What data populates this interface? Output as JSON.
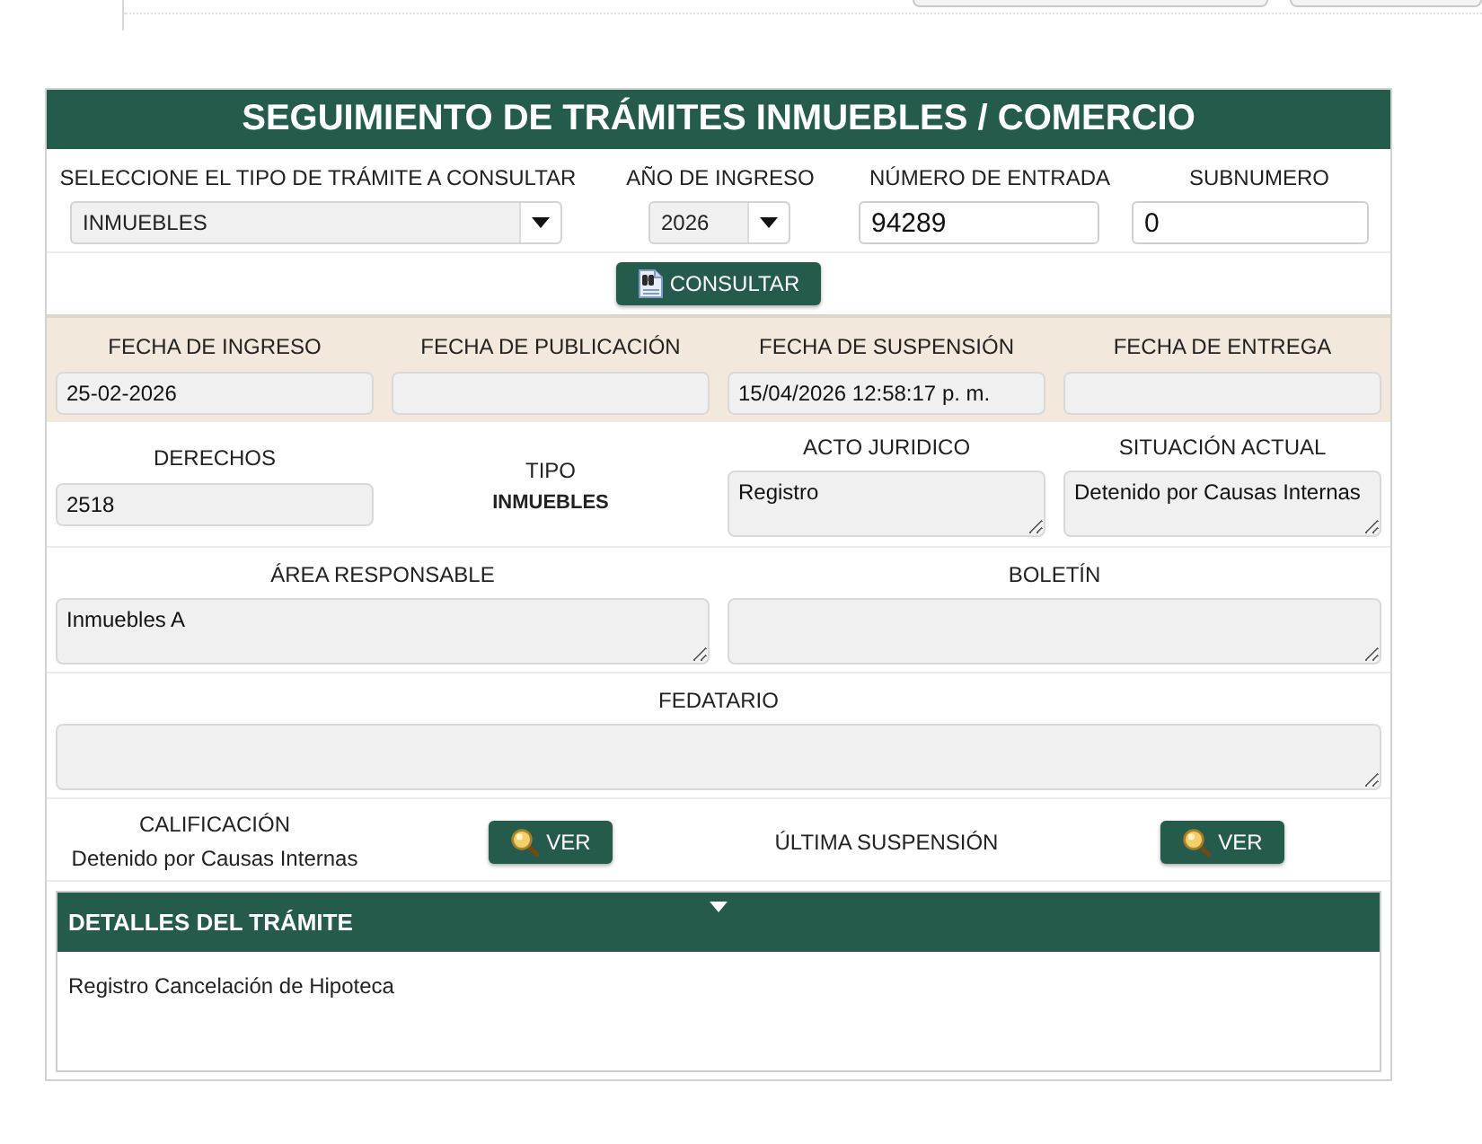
{
  "header": {
    "title": "SEGUIMIENTO DE TRÁMITES INMUEBLES / COMERCIO"
  },
  "search": {
    "fields": [
      {
        "kind": "select",
        "label": "SELECCIONE EL TIPO DE TRÁMITE A CONSULTAR",
        "value": "INMUEBLES"
      },
      {
        "kind": "select",
        "label": "AÑO DE INGRESO",
        "value": "2026"
      },
      {
        "kind": "input",
        "label": "NÚMERO DE ENTRADA",
        "value": "94289"
      },
      {
        "kind": "input",
        "label": "SUBNUMERO",
        "value": "0"
      }
    ],
    "button": "CONSULTAR"
  },
  "dates": [
    {
      "label": "FECHA DE INGRESO",
      "value": "25-02-2026"
    },
    {
      "label": "FECHA DE PUBLICACIÓN"
    },
    {
      "label": "FECHA DE SUSPENSIÓN",
      "value": "15/04/2026 12:58:17 p. m."
    },
    {
      "label": "FECHA DE ENTREGA"
    }
  ],
  "info": [
    {
      "kind": "field",
      "label": "DERECHOS",
      "value": "2518"
    },
    {
      "kind": "text",
      "label": "TIPO",
      "value": "INMUEBLES"
    },
    {
      "kind": "textarea",
      "label": "ACTO JURIDICO",
      "value": "Registro"
    },
    {
      "kind": "textarea",
      "label": "SITUACIÓN ACTUAL",
      "value": "Detenido por Causas Internas"
    }
  ],
  "assignment": [
    {
      "label": "ÁREA RESPONSABLE",
      "value": "Inmuebles A"
    },
    {
      "label": "BOLETÍN"
    }
  ],
  "fedatario": {
    "label": "FEDATARIO"
  },
  "results": [
    {
      "kind": "text",
      "label": "CALIFICACIÓN",
      "value": "Detenido por Causas Internas"
    },
    {
      "kind": "button",
      "label": "VER"
    },
    {
      "kind": "text",
      "label": "ÚLTIMA SUSPENSIÓN"
    },
    {
      "kind": "button",
      "label": "VER"
    }
  ],
  "details": {
    "title": "DETALLES DEL TRÁMITE",
    "expanded": true,
    "text": "Registro Cancelación de Hipoteca"
  }
}
